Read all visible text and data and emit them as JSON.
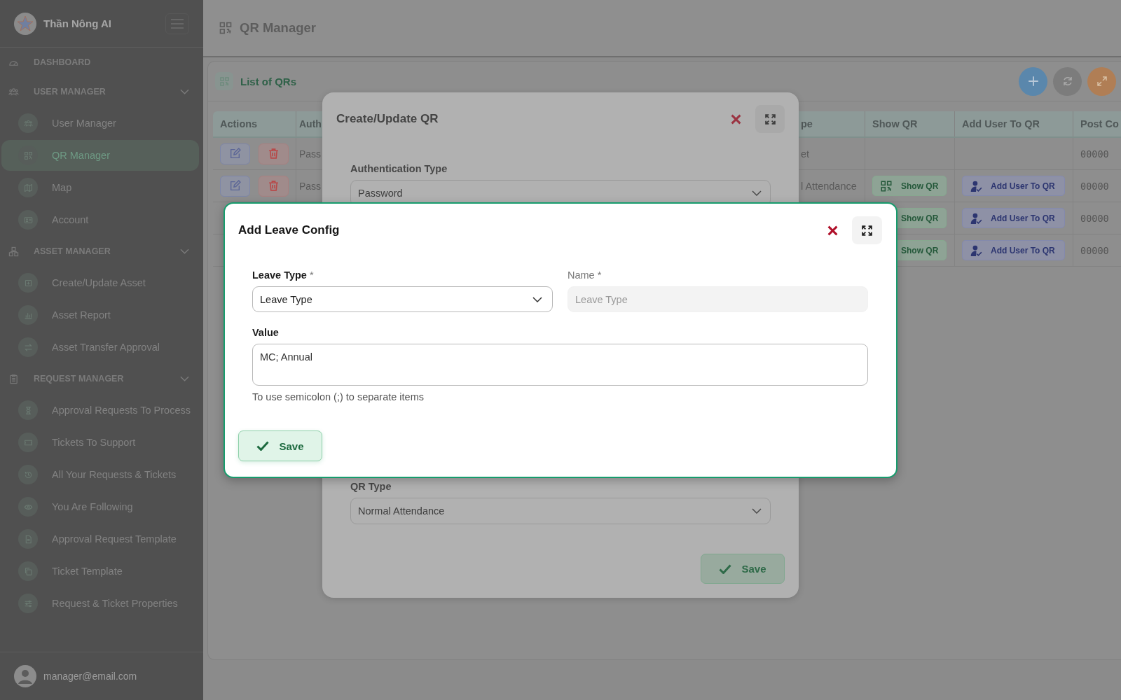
{
  "sidebar": {
    "brand": "Thần Nông AI",
    "sections": [
      {
        "title": "DASHBOARD",
        "kind": "link"
      },
      {
        "title": "USER MANAGER",
        "kind": "group",
        "expanded": true,
        "children": [
          {
            "label": "User Manager",
            "selected": false
          },
          {
            "label": "QR Manager",
            "selected": true
          },
          {
            "label": "Map",
            "selected": false
          },
          {
            "label": "Account",
            "selected": false
          }
        ]
      },
      {
        "title": "ASSET MANAGER",
        "kind": "group",
        "expanded": true,
        "children": [
          {
            "label": "Create/Update Asset",
            "selected": false
          },
          {
            "label": "Asset Report",
            "selected": false
          },
          {
            "label": "Asset Transfer Approval",
            "selected": false
          }
        ]
      },
      {
        "title": "REQUEST MANAGER",
        "kind": "group",
        "expanded": true,
        "children": [
          {
            "label": "Approval Requests To Process",
            "selected": false
          },
          {
            "label": "Tickets To Support",
            "selected": false
          },
          {
            "label": "All Your Requests & Tickets",
            "selected": false
          },
          {
            "label": "You Are Following",
            "selected": false
          },
          {
            "label": "Approval Request Template",
            "selected": false
          },
          {
            "label": "Ticket Template",
            "selected": false
          },
          {
            "label": "Request & Ticket Properties",
            "selected": false
          }
        ]
      }
    ],
    "user": "manager@email.com"
  },
  "header": {
    "title": "QR Manager"
  },
  "card": {
    "title": "List of QRs"
  },
  "table": {
    "columns": [
      "Actions",
      "Auth",
      "pe",
      "Show QR",
      "Add User To QR",
      "Post Co"
    ],
    "rows": [
      {
        "auth": "Pass",
        "type": "et",
        "post": "00000"
      },
      {
        "auth": "Pass",
        "type": "l Attendance",
        "show_qr": "Show QR",
        "add_user": "Add User To QR",
        "post": "00000"
      },
      {
        "show_qr": "Show QR",
        "add_user": "Add User To QR",
        "post": "00000"
      },
      {
        "show_qr": "Show QR",
        "add_user": "Add User To QR",
        "post": "00000"
      }
    ]
  },
  "qr_dialog": {
    "title": "Create/Update QR",
    "fields": [
      {
        "label": "Authentication Type",
        "value": "Password"
      },
      {
        "label": "QR Type",
        "value": "Normal Attendance"
      }
    ],
    "save": "Save"
  },
  "leave_dialog": {
    "title": "Add Leave Config",
    "leave_type": {
      "label": "Leave Type",
      "required": "*",
      "value": "Leave Type"
    },
    "name": {
      "label": "Name",
      "required": "*",
      "placeholder": "Leave Type",
      "disabled": true
    },
    "value": {
      "label": "Value",
      "value": "MC; Annual",
      "hint": "To use semicolon (;) to separate items"
    },
    "save": "Save"
  }
}
